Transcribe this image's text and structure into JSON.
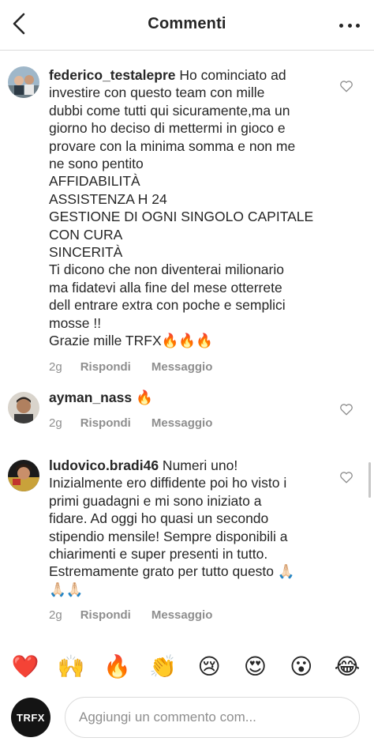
{
  "header": {
    "title": "Commenti",
    "back_icon": "chevron-left-icon",
    "more_icon": "more-dots-icon"
  },
  "comments": [
    {
      "username": "federico_testalepre",
      "text": " Ho cominciato ad\ninvestire con questo team con mille\ndubbi come tutti qui sicuramente,ma un\ngiorno ho deciso di mettermi in gioco e\nprovare con la minima somma e non me\nne sono pentito\nAFFIDABILITÀ\nASSISTENZA H 24\nGESTIONE DI OGNI SINGOLO CAPITALE\nCON CURA\nSINCERITÀ\nTi dicono che non diventerai milionario\nma fidatevi alla fine del mese otterrete\ndell entrare extra con poche e semplici\nmosse !!\nGrazie mille TRFX🔥🔥🔥",
      "time": "2g",
      "reply": "Rispondi",
      "message": "Messaggio"
    },
    {
      "username": "ayman_nass",
      "text": " 🔥",
      "time": "2g",
      "reply": "Rispondi",
      "message": "Messaggio"
    },
    {
      "username": "ludovico.bradi46",
      "text": " Numeri uno!\nInizialmente ero diffidente poi ho visto i\nprimi guadagni e mi sono iniziato a\nfidare. Ad oggi ho quasi un secondo\nstipendio mensile! Sempre disponibili a\nchiarimenti e super presenti in tutto.\nEstremamente grato per tutto questo 🙏🏻\n🙏🏻🙏🏻",
      "time": "2g",
      "reply": "Rispondi",
      "message": "Messaggio"
    }
  ],
  "emoji_bar": [
    "❤️",
    "🙌",
    "🔥",
    "👏",
    "😢",
    "😍",
    "😮",
    "😂"
  ],
  "composer": {
    "avatar_label": "TRFX",
    "placeholder": "Aggiungi un commento com..."
  }
}
